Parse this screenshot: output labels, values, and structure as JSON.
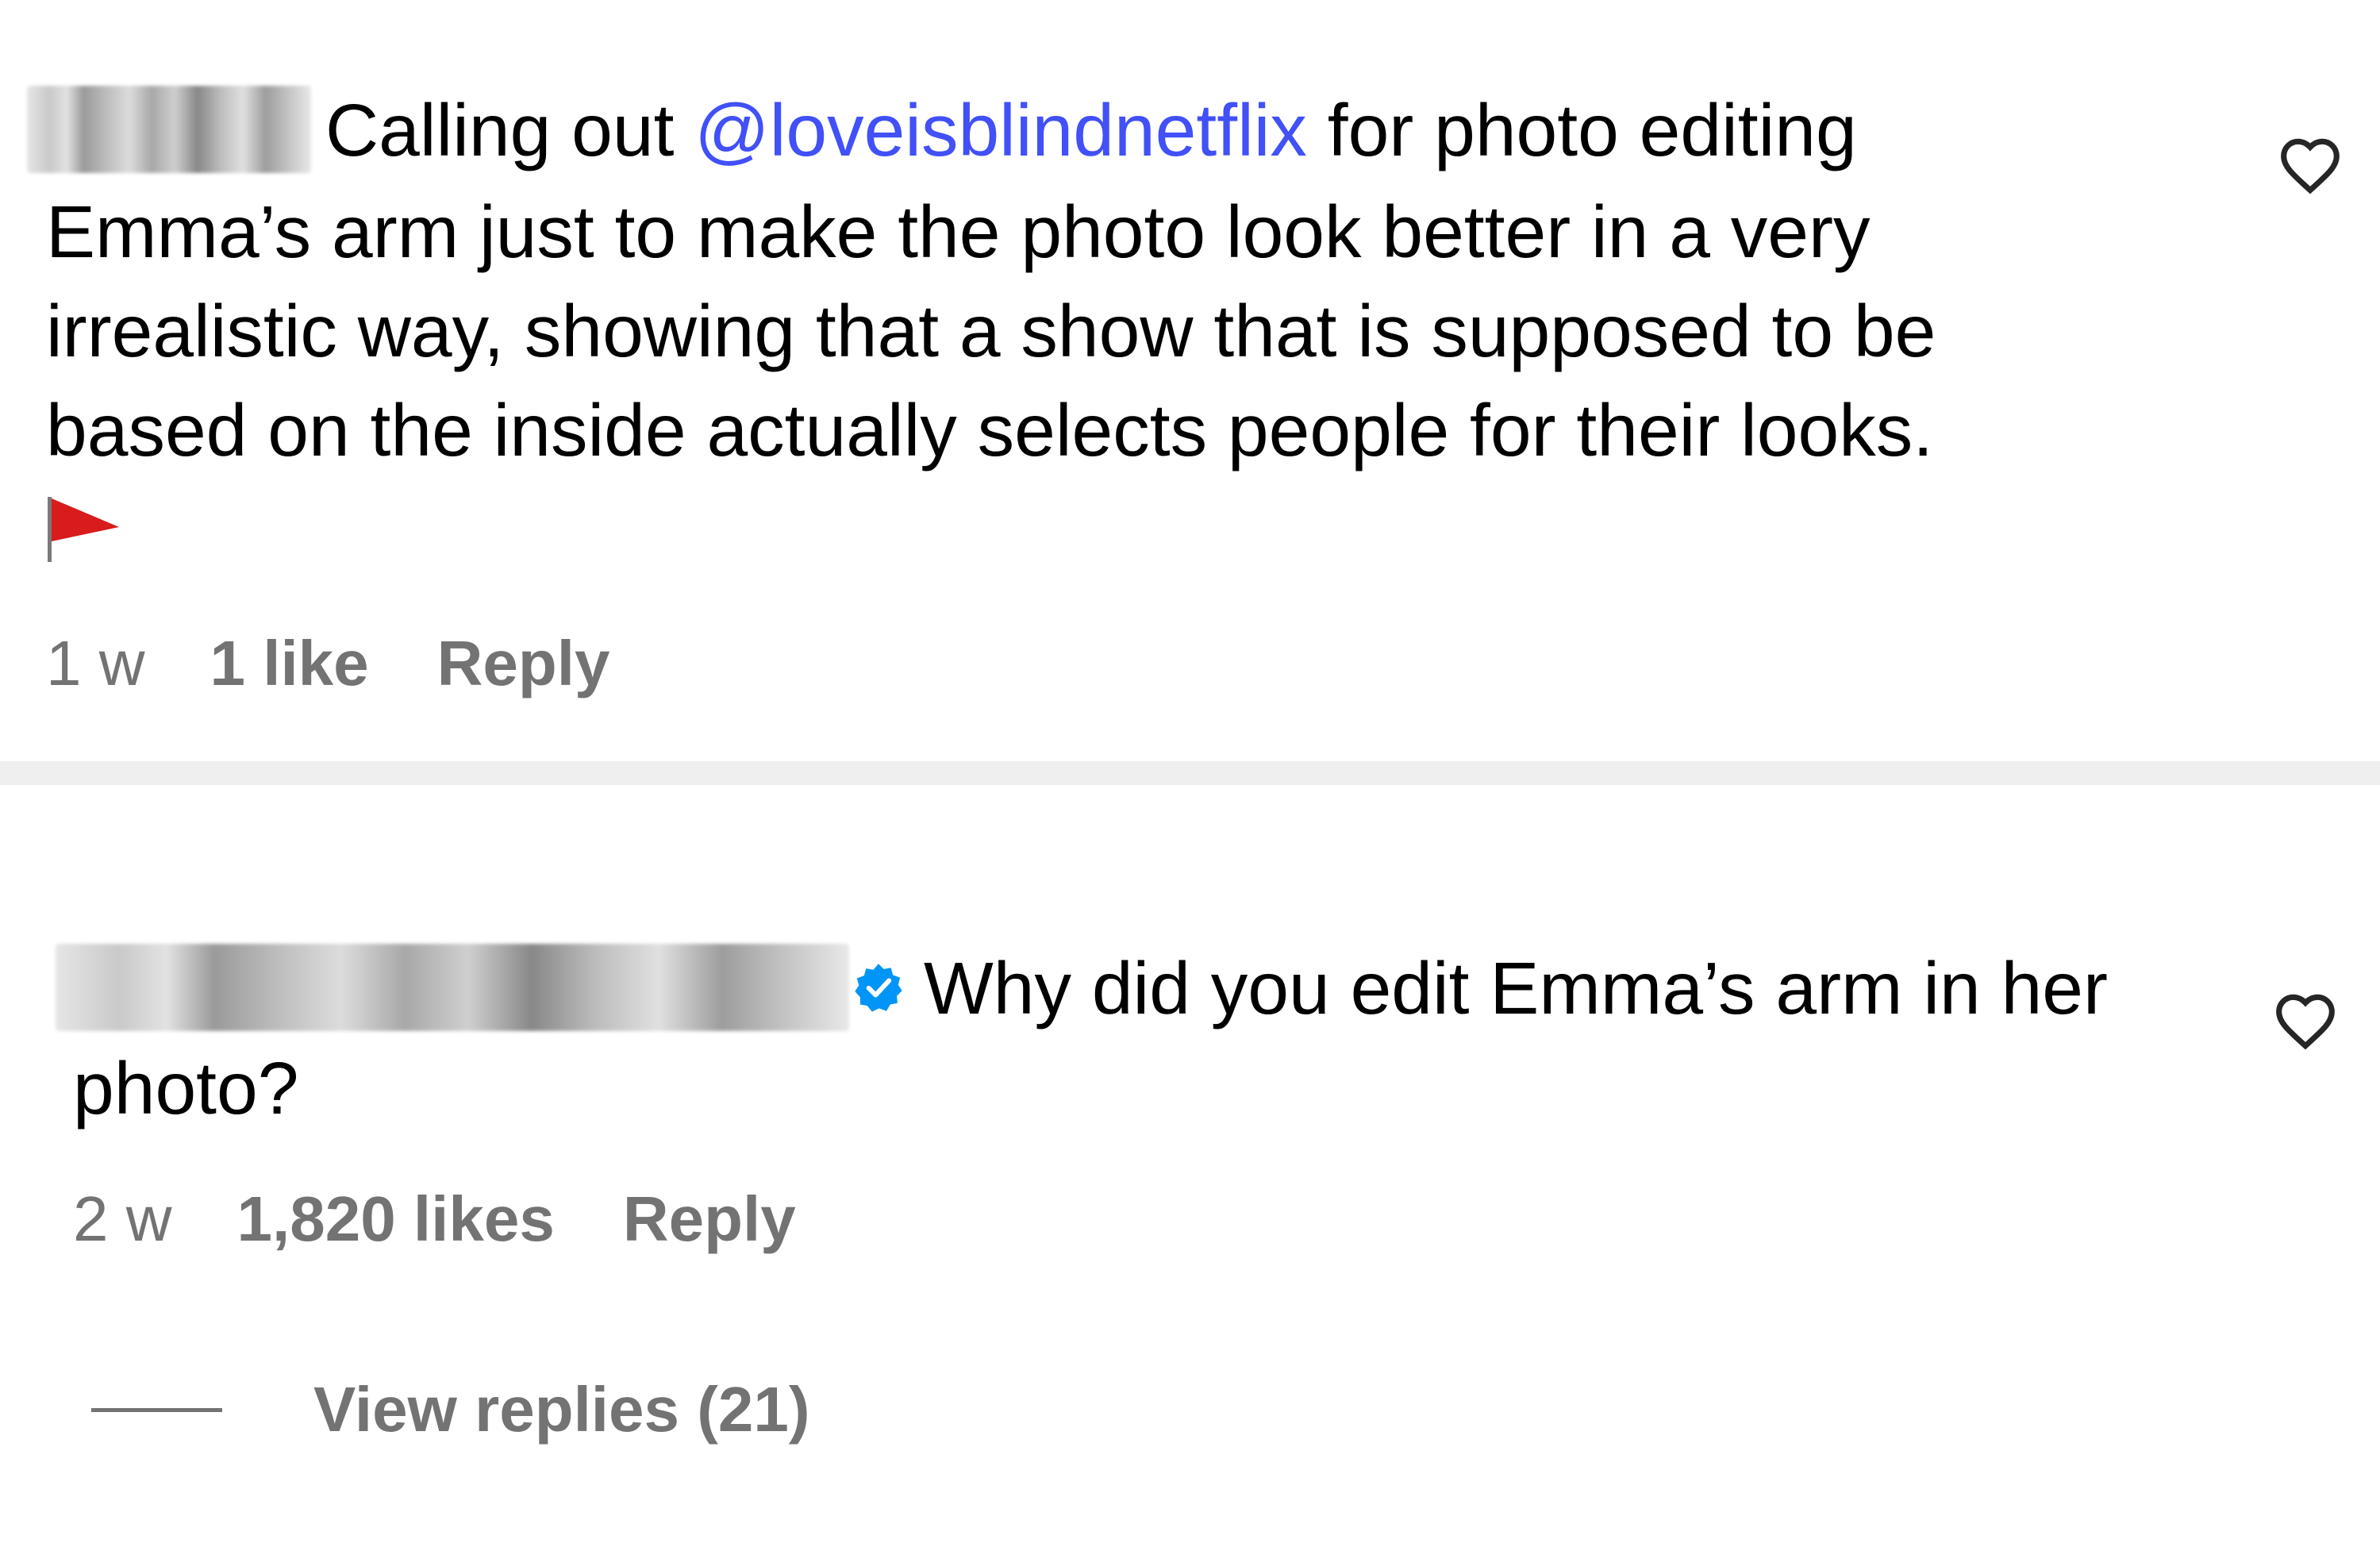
{
  "comments": [
    {
      "lead_text": "Calling out ",
      "mention": "@loveisblindnetflix",
      "line1_rest": " for photo editing",
      "line2": "Emma’s arm just to make the photo look better in a very",
      "line3": "irrealistic way, showing that a show that is supposed to be",
      "line4": "based on the inside actually selects people for their looks.",
      "emoji_icon": "red-flag-icon",
      "time": "1 w",
      "likes": "1 like",
      "reply_label": "Reply",
      "like_icon": "heart-outline-icon"
    },
    {
      "line1": "Why did you edit Emma’s arm in her",
      "line2": "photo?",
      "verified_icon": "verified-badge-icon",
      "time": "2 w",
      "likes": "1,820 likes",
      "reply_label": "Reply",
      "like_icon": "heart-outline-icon",
      "view_replies": "View replies (21)"
    }
  ],
  "colors": {
    "mention": "#4150f7",
    "meta": "#737373",
    "verified": "#0095f6",
    "flag": "#d81b1b",
    "divider": "#efefef"
  }
}
